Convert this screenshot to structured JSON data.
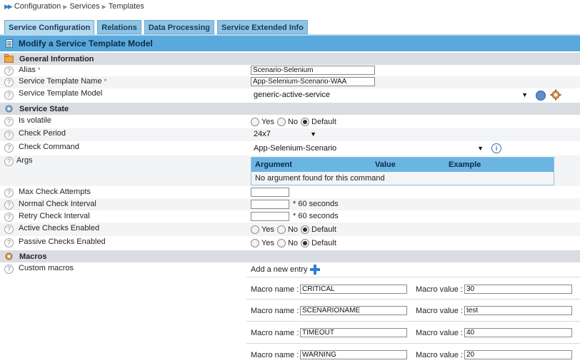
{
  "breadcrumb": {
    "items": [
      "Configuration",
      "Services",
      "Templates"
    ]
  },
  "tabs": [
    {
      "label": "Service Configuration",
      "active": true
    },
    {
      "label": "Relations",
      "active": false
    },
    {
      "label": "Data Processing",
      "active": false
    },
    {
      "label": "Service Extended Info",
      "active": false
    }
  ],
  "page_title": "Modify a Service Template Model",
  "sections": {
    "general": "General Information",
    "state": "Service State",
    "macros": "Macros"
  },
  "fields": {
    "alias": {
      "label": "Alias",
      "required_mark": "*",
      "value": "Scenario-Selenium"
    },
    "template_name": {
      "label": "Service Template Name",
      "required_mark": "*",
      "value": "App-Selenium-Scenario-WAA"
    },
    "template_model": {
      "label": "Service Template Model",
      "value": "generic-active-service"
    },
    "is_volatile": {
      "label": "Is volatile",
      "options": [
        "Yes",
        "No",
        "Default"
      ],
      "selected": "Default"
    },
    "check_period": {
      "label": "Check Period",
      "value": "24x7"
    },
    "check_command": {
      "label": "Check Command",
      "value": "App-Selenium-Scenario"
    },
    "args": {
      "label": "Args"
    },
    "max_check_attempts": {
      "label": "Max Check Attempts",
      "value": ""
    },
    "normal_check_interval": {
      "label": "Normal Check Interval",
      "value": "",
      "suffix": "* 60 seconds"
    },
    "retry_check_interval": {
      "label": "Retry Check Interval",
      "value": "",
      "suffix": "* 60 seconds"
    },
    "active_checks": {
      "label": "Active Checks Enabled",
      "options": [
        "Yes",
        "No",
        "Default"
      ],
      "selected": "Default"
    },
    "passive_checks": {
      "label": "Passive Checks Enabled",
      "options": [
        "Yes",
        "No",
        "Default"
      ],
      "selected": "Default"
    }
  },
  "args_table": {
    "headers": [
      "Argument",
      "Value",
      "Example"
    ],
    "empty_message": "No argument found for this command"
  },
  "macros": {
    "label": "Custom macros",
    "add_entry": "Add a new entry",
    "name_label": "Macro name :",
    "value_label": "Macro value :",
    "entries": [
      {
        "name": "CRITICAL",
        "value": "30"
      },
      {
        "name": "SCENARIONAME",
        "value": "test"
      },
      {
        "name": "TIMEOUT",
        "value": "40"
      },
      {
        "name": "WARNING",
        "value": "20"
      }
    ]
  },
  "colors": {
    "tab_bg": "#8dc3e3",
    "title_bar": "#5aa9dc",
    "section_bg": "#d9dde2",
    "required": "#dd2222",
    "add_icon": "#2d7fd4"
  },
  "icons": {
    "breadcrumb": "double-chevron-right-icon",
    "title": "document-icon",
    "help": "question-mark-icon",
    "model_info": "info-circle-icon",
    "model_settings": "gear-icon",
    "command_info": "info-icon",
    "add": "plus-icon"
  }
}
